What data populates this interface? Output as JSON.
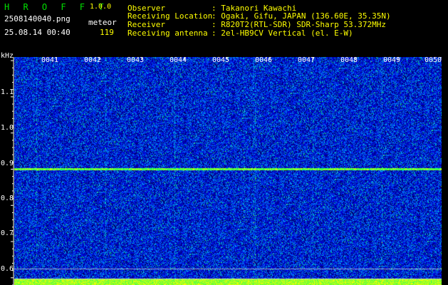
{
  "header": {
    "app_name": "H R O F F T",
    "version": "1.0.0",
    "filename": "2508140040.png",
    "timestamp": "25.08.14 00:40",
    "meteor_label": "meteor",
    "meteor_count": "119"
  },
  "info": {
    "observer_key": "Observer",
    "observer_value": ": Takanori Kawachi",
    "location_key": "Receiving Location",
    "location_value": ": Ogaki, Gifu, JAPAN (136.60E, 35.35N)",
    "receiver_key": "Receiver",
    "receiver_value": ": R820T2(RTL-SDR) SDR-Sharp 53.372MHz",
    "antenna_key": "Receiving antenna",
    "antenna_value": ": 2el-HB9CV Vertical (el. E-W)"
  },
  "axis": {
    "unit": "kHz",
    "y_ticks": [
      "1.1",
      "1.0",
      "0.9",
      "0.8",
      "0.7",
      "0.6"
    ],
    "x_ticks": [
      "0041",
      "0042",
      "0043",
      "0044",
      "0045",
      "0046",
      "0047",
      "0048",
      "0049",
      "0050"
    ]
  },
  "chart_data": {
    "type": "heatmap",
    "title": "",
    "xlabel": "",
    "ylabel": "kHz",
    "x_ticks": [
      "0041",
      "0042",
      "0043",
      "0044",
      "0045",
      "0046",
      "0047",
      "0048",
      "0049",
      "0050"
    ],
    "y_ticks": [
      1.1,
      1.0,
      0.9,
      0.8,
      0.7,
      0.6
    ],
    "ylim": [
      0.58,
      1.21
    ],
    "persistent_carrier_khz": 0.9,
    "colormap": [
      "#000050",
      "#0000ff",
      "#00c0ff",
      "#00ff80",
      "#ffff00"
    ],
    "grid": false
  },
  "colors": {
    "background": "#000000",
    "brand": "#00e000",
    "highlight": "#ffff00",
    "text": "#ffffff"
  }
}
